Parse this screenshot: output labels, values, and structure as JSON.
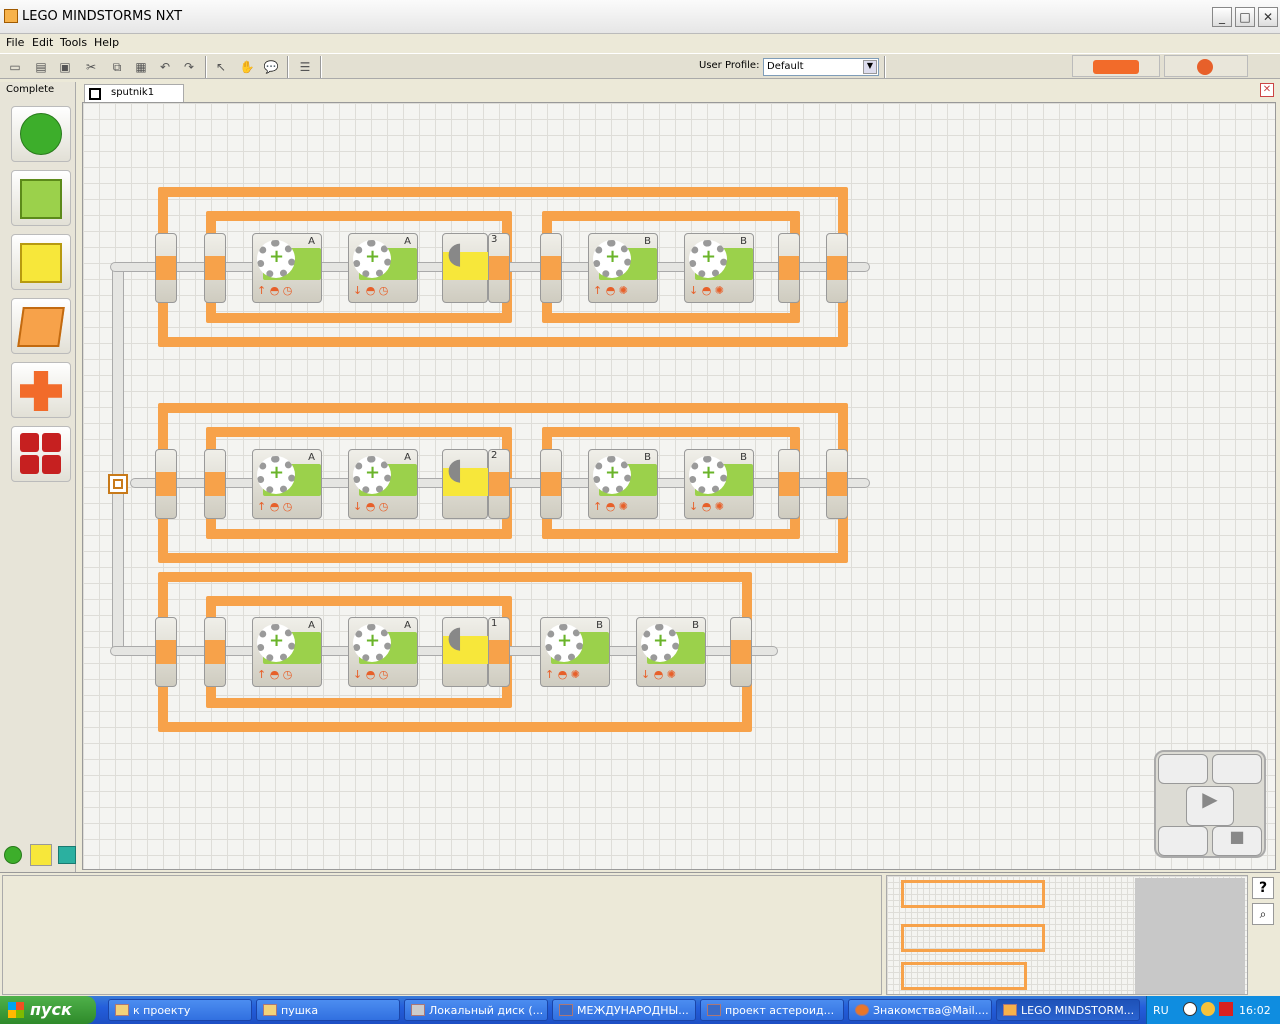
{
  "window": {
    "title": "LEGO MINDSTORMS NXT",
    "min": "_",
    "max": "□",
    "close": "✕"
  },
  "menu": [
    "File",
    "Edit",
    "Tools",
    "Help"
  ],
  "toolbar": {
    "user_profile_label": "User Profile:",
    "user_profile_value": "Default"
  },
  "palette": {
    "label": "Complete",
    "items": [
      "move-block",
      "record-play-block",
      "sound-block",
      "display-block",
      "wait-block",
      "loop-block"
    ]
  },
  "document": {
    "tab_label": "sputnik1"
  },
  "rows": [
    {
      "inner_loop_left": [
        "A",
        "A"
      ],
      "sound_count": "3",
      "inner_loop_right": [
        "B",
        "B"
      ]
    },
    {
      "inner_loop_left": [
        "A",
        "A"
      ],
      "sound_count": "2",
      "inner_loop_right": [
        "B",
        "B"
      ]
    },
    {
      "inner_loop_left": [
        "A",
        "A"
      ],
      "sound_count": "1",
      "motors_right": [
        "B",
        "B"
      ]
    }
  ],
  "controller": {
    "play": "▶",
    "stop": "■"
  },
  "help_button": "?",
  "zoom_button": "🔍",
  "taskbar": {
    "start": "пуск",
    "tasks": [
      "к проекту",
      "пушка",
      "Локальный диск (...",
      "МЕЖДУНАРОДНЫ...",
      "проект астероид...",
      "Знакомства@Mail....",
      "LEGO MINDSTORM..."
    ],
    "lang": "RU",
    "clock": "16:02"
  },
  "colors": {
    "loop": "#f7a24a",
    "motor_green": "#9bd14b",
    "sound_yellow": "#f7e73a",
    "taskbar": "#245edb"
  }
}
